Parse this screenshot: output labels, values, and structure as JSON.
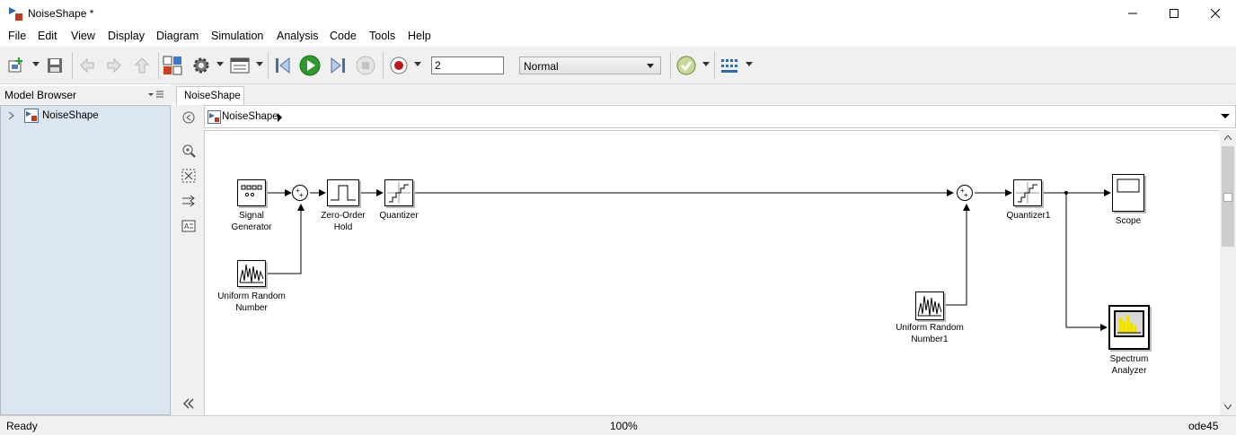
{
  "window": {
    "title": "NoiseShape *"
  },
  "menu": [
    "File",
    "Edit",
    "View",
    "Display",
    "Diagram",
    "Simulation",
    "Analysis",
    "Code",
    "Tools",
    "Help"
  ],
  "toolbar": {
    "stop_time": "2",
    "sim_mode": "Normal",
    "icons": [
      "new-model-icon",
      "save-icon",
      "back-icon",
      "forward-icon",
      "up-icon",
      "library-browser-icon",
      "model-config-icon",
      "model-explorer-icon",
      "step-back-icon",
      "run-icon",
      "step-forward-icon",
      "stop-icon",
      "record-icon",
      "check-icon",
      "build-icon"
    ]
  },
  "model_browser": {
    "title": "Model Browser",
    "root": "NoiseShape"
  },
  "tab": {
    "label": "NoiseShape"
  },
  "breadcrumb": {
    "model": "NoiseShape"
  },
  "blocks": {
    "signal_generator": "Signal\nGenerator",
    "uniform_random": "Uniform Random\nNumber",
    "zoh": "Zero-Order\nHold",
    "quantizer": "Quantizer",
    "uniform_random1": "Uniform Random\nNumber1",
    "quantizer1": "Quantizer1",
    "scope": "Scope",
    "spectrum": "Spectrum\nAnalyzer"
  },
  "status": {
    "left": "Ready",
    "zoom": "100%",
    "solver": "ode45"
  },
  "colors": {
    "run_green": "#2e9a2e",
    "browser_bg": "#dce6f0",
    "spectrum_bg": "#d8d8d8",
    "spectrum_bars": "#f0e000"
  }
}
